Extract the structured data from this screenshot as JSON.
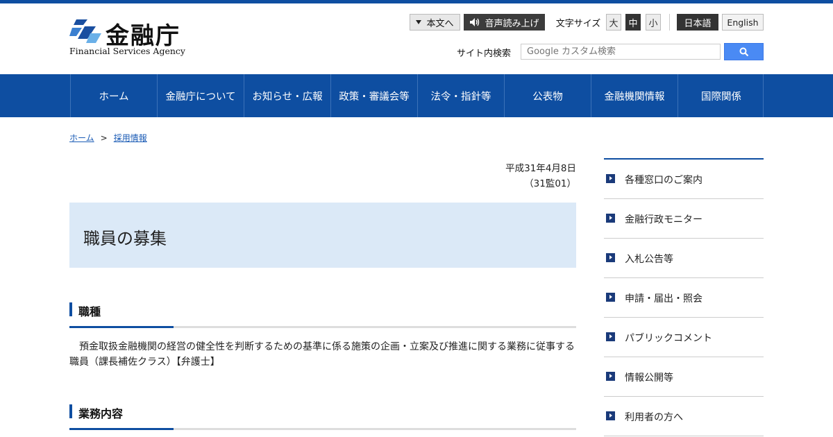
{
  "header": {
    "logo_jp": "金融庁",
    "logo_en": "Financial Services Agency",
    "skip_label": "本文へ",
    "speech_label": "音声読み上げ",
    "font_size_label": "文字サイズ",
    "font_sizes": [
      "大",
      "中",
      "小"
    ],
    "lang_ja": "日本語",
    "lang_en": "English",
    "search_label": "サイト内検索",
    "search_placeholder": "Google カスタム検索"
  },
  "nav": {
    "items": [
      "ホーム",
      "金融庁について",
      "お知らせ・広報",
      "政策・審議会等",
      "法令・指針等",
      "公表物",
      "金融機関情報",
      "国際関係"
    ]
  },
  "breadcrumb": {
    "home": "ホーム",
    "separator": ">",
    "current": "採用情報"
  },
  "meta": {
    "date": "平成31年4月8日",
    "number": "（31監01）"
  },
  "page": {
    "title": "職員の募集",
    "sections": [
      {
        "heading": "職種",
        "body": "　預金取扱金融機関の経営の健全性を判断するための基準に係る施策の企画・立案及び推進に関する業務に従事する職員（課長補佐クラス）【弁護士】"
      },
      {
        "heading": "業務内容"
      }
    ]
  },
  "sidebar": {
    "items": [
      "各種窓口のご案内",
      "金融行政モニター",
      "入札公告等",
      "申請・届出・照会",
      "パブリックコメント",
      "情報公開等",
      "利用者の方へ"
    ]
  },
  "colors": {
    "brand": "#0e4ea1",
    "title_bg": "#dbe9f7",
    "search_button": "#4a8af4"
  }
}
